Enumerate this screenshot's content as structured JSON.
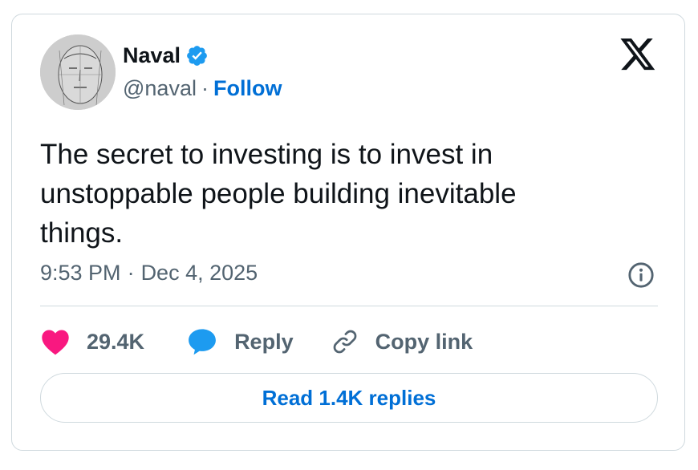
{
  "author": {
    "name": "Naval",
    "handle": "@naval",
    "separator": "·",
    "follow_label": "Follow",
    "verified_color": "#1d9bf0"
  },
  "tweet": {
    "text": "The secret to investing is to invest in unstoppable people building inevitable things.",
    "time": "9:53 PM",
    "separator": "·",
    "date": "Dec 4, 2025"
  },
  "actions": {
    "like_count": "29.4K",
    "reply_label": "Reply",
    "copy_link_label": "Copy link",
    "like_color": "#f91880",
    "reply_color": "#1d9bf0"
  },
  "read_replies_label": "Read 1.4K replies",
  "icons": [
    "x-logo-icon",
    "verified-badge-icon",
    "info-icon",
    "heart-icon",
    "reply-bubble-icon",
    "link-icon"
  ],
  "colors": {
    "link_blue": "#006fd6",
    "text_primary": "#0f1419",
    "text_secondary": "#536471",
    "border": "#cfd9de"
  }
}
